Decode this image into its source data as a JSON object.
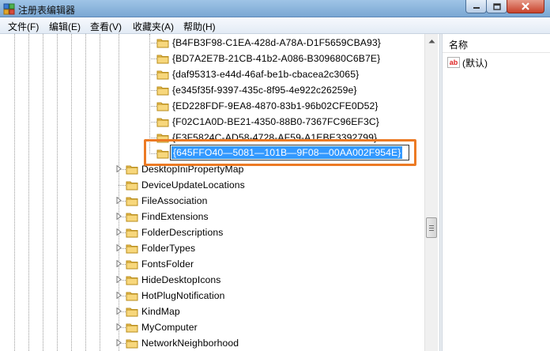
{
  "window": {
    "title": "注册表编辑器"
  },
  "menu": [
    {
      "label": "文件(F)"
    },
    {
      "label": "编辑(E)"
    },
    {
      "label": "查看(V)"
    },
    {
      "label": "收藏夹(A)"
    },
    {
      "label": "帮助(H)"
    }
  ],
  "tree": {
    "guid_items": [
      {
        "label": "{B4FB3F98-C1EA-428d-A78A-D1F5659CBA93}"
      },
      {
        "label": "{BD7A2E7B-21CB-41b2-A086-B309680C6B7E}"
      },
      {
        "label": "{daf95313-e44d-46af-be1b-cbacea2c3065}"
      },
      {
        "label": "{e345f35f-9397-435c-8f95-4e922c26259e}"
      },
      {
        "label": "{ED228FDF-9EA8-4870-83b1-96b02CFE0D52}"
      },
      {
        "label": "{F02C1A0D-BE21-4350-88B0-7367FC96EF3C}"
      },
      {
        "label": "{F3F5824C-AD58-4728-AF59-A1EBE3392799}"
      }
    ],
    "editing_item": {
      "value": "{645FFO40—5081—101B—9F08—00AA002F954E}"
    },
    "keys": [
      {
        "label": "DesktopIniPropertyMap"
      },
      {
        "label": "DeviceUpdateLocations"
      },
      {
        "label": "FileAssociation"
      },
      {
        "label": "FindExtensions"
      },
      {
        "label": "FolderDescriptions"
      },
      {
        "label": "FolderTypes"
      },
      {
        "label": "FontsFolder"
      },
      {
        "label": "HideDesktopIcons"
      },
      {
        "label": "HotPlugNotification"
      },
      {
        "label": "KindMap"
      },
      {
        "label": "MyComputer"
      },
      {
        "label": "NetworkNeighborhood"
      }
    ]
  },
  "values_pane": {
    "column_name": "名称",
    "rows": [
      {
        "icon": "ab-string-icon",
        "name": "(默认)"
      }
    ]
  },
  "colors": {
    "selection": "#3399ff",
    "highlight_outline": "#ec7a24",
    "folder": "#f2c75c"
  }
}
